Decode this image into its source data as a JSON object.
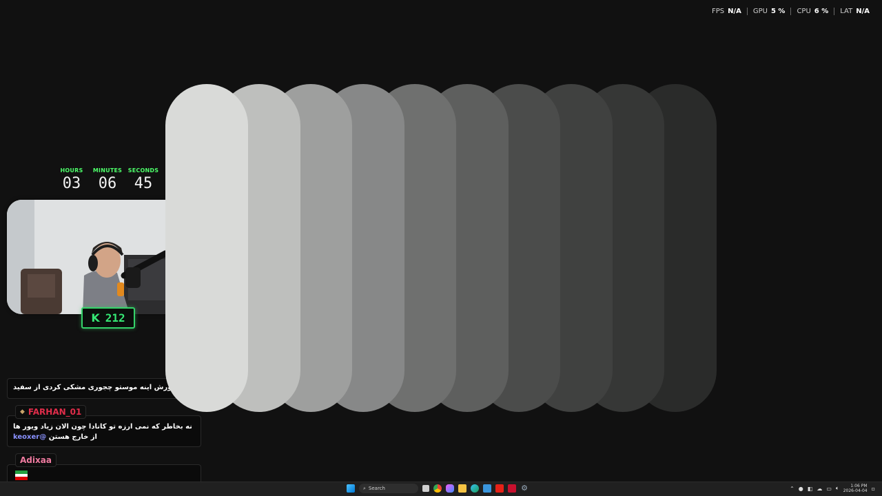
{
  "stats": {
    "fps_label": "FPS",
    "fps_value": "N/A",
    "gpu_label": "GPU",
    "gpu_value": "5 %",
    "cpu_label": "CPU",
    "cpu_value": "6 %",
    "lat_label": "LAT",
    "lat_value": "N/A"
  },
  "wheel": {
    "colors": [
      "#d9dad8",
      "#bebfbd",
      "#9e9f9e",
      "#878888",
      "#6f706f",
      "#5e5f5e",
      "#4b4c4b",
      "#404140",
      "#363736",
      "#2a2b2a"
    ]
  },
  "timer": {
    "hours_label": "HOURS",
    "hours": "03",
    "minutes_label": "MINUTES",
    "minutes": "06",
    "seconds_label": "SECONDS",
    "seconds": "45"
  },
  "badge": {
    "letter": "K",
    "count": "212"
  },
  "chat": {
    "messages": [
      {
        "user": "",
        "text": "منظورش اینه موستو چجوری مشکی کردی از سفید",
        "mention": ""
      },
      {
        "user": "FARHAN_01",
        "text": "نه بخاطر که نمی ارزه تو کانادا چون الان زیاد ویور ها از خارج هستن",
        "mention": "@keoxer"
      },
      {
        "user": "Adixaa",
        "text": "",
        "mention": ""
      }
    ],
    "colors": {
      "farhan": "#e02d4a",
      "adixaa": "#f07ba0"
    }
  },
  "taskbar": {
    "search_placeholder": "Search",
    "clock_time": "1:06 PM",
    "clock_date": "2026-04-04"
  }
}
